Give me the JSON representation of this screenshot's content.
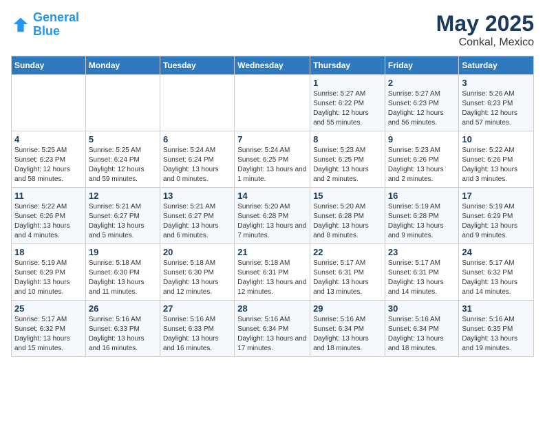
{
  "header": {
    "logo_general": "General",
    "logo_blue": "Blue",
    "month": "May 2025",
    "location": "Conkal, Mexico"
  },
  "weekdays": [
    "Sunday",
    "Monday",
    "Tuesday",
    "Wednesday",
    "Thursday",
    "Friday",
    "Saturday"
  ],
  "weeks": [
    [
      {
        "day": "",
        "sunrise": "",
        "sunset": "",
        "daylight": ""
      },
      {
        "day": "",
        "sunrise": "",
        "sunset": "",
        "daylight": ""
      },
      {
        "day": "",
        "sunrise": "",
        "sunset": "",
        "daylight": ""
      },
      {
        "day": "",
        "sunrise": "",
        "sunset": "",
        "daylight": ""
      },
      {
        "day": "1",
        "sunrise": "Sunrise: 5:27 AM",
        "sunset": "Sunset: 6:22 PM",
        "daylight": "Daylight: 12 hours and 55 minutes."
      },
      {
        "day": "2",
        "sunrise": "Sunrise: 5:27 AM",
        "sunset": "Sunset: 6:23 PM",
        "daylight": "Daylight: 12 hours and 56 minutes."
      },
      {
        "day": "3",
        "sunrise": "Sunrise: 5:26 AM",
        "sunset": "Sunset: 6:23 PM",
        "daylight": "Daylight: 12 hours and 57 minutes."
      }
    ],
    [
      {
        "day": "4",
        "sunrise": "Sunrise: 5:25 AM",
        "sunset": "Sunset: 6:23 PM",
        "daylight": "Daylight: 12 hours and 58 minutes."
      },
      {
        "day": "5",
        "sunrise": "Sunrise: 5:25 AM",
        "sunset": "Sunset: 6:24 PM",
        "daylight": "Daylight: 12 hours and 59 minutes."
      },
      {
        "day": "6",
        "sunrise": "Sunrise: 5:24 AM",
        "sunset": "Sunset: 6:24 PM",
        "daylight": "Daylight: 13 hours and 0 minutes."
      },
      {
        "day": "7",
        "sunrise": "Sunrise: 5:24 AM",
        "sunset": "Sunset: 6:25 PM",
        "daylight": "Daylight: 13 hours and 1 minute."
      },
      {
        "day": "8",
        "sunrise": "Sunrise: 5:23 AM",
        "sunset": "Sunset: 6:25 PM",
        "daylight": "Daylight: 13 hours and 2 minutes."
      },
      {
        "day": "9",
        "sunrise": "Sunrise: 5:23 AM",
        "sunset": "Sunset: 6:26 PM",
        "daylight": "Daylight: 13 hours and 2 minutes."
      },
      {
        "day": "10",
        "sunrise": "Sunrise: 5:22 AM",
        "sunset": "Sunset: 6:26 PM",
        "daylight": "Daylight: 13 hours and 3 minutes."
      }
    ],
    [
      {
        "day": "11",
        "sunrise": "Sunrise: 5:22 AM",
        "sunset": "Sunset: 6:26 PM",
        "daylight": "Daylight: 13 hours and 4 minutes."
      },
      {
        "day": "12",
        "sunrise": "Sunrise: 5:21 AM",
        "sunset": "Sunset: 6:27 PM",
        "daylight": "Daylight: 13 hours and 5 minutes."
      },
      {
        "day": "13",
        "sunrise": "Sunrise: 5:21 AM",
        "sunset": "Sunset: 6:27 PM",
        "daylight": "Daylight: 13 hours and 6 minutes."
      },
      {
        "day": "14",
        "sunrise": "Sunrise: 5:20 AM",
        "sunset": "Sunset: 6:28 PM",
        "daylight": "Daylight: 13 hours and 7 minutes."
      },
      {
        "day": "15",
        "sunrise": "Sunrise: 5:20 AM",
        "sunset": "Sunset: 6:28 PM",
        "daylight": "Daylight: 13 hours and 8 minutes."
      },
      {
        "day": "16",
        "sunrise": "Sunrise: 5:19 AM",
        "sunset": "Sunset: 6:28 PM",
        "daylight": "Daylight: 13 hours and 9 minutes."
      },
      {
        "day": "17",
        "sunrise": "Sunrise: 5:19 AM",
        "sunset": "Sunset: 6:29 PM",
        "daylight": "Daylight: 13 hours and 9 minutes."
      }
    ],
    [
      {
        "day": "18",
        "sunrise": "Sunrise: 5:19 AM",
        "sunset": "Sunset: 6:29 PM",
        "daylight": "Daylight: 13 hours and 10 minutes."
      },
      {
        "day": "19",
        "sunrise": "Sunrise: 5:18 AM",
        "sunset": "Sunset: 6:30 PM",
        "daylight": "Daylight: 13 hours and 11 minutes."
      },
      {
        "day": "20",
        "sunrise": "Sunrise: 5:18 AM",
        "sunset": "Sunset: 6:30 PM",
        "daylight": "Daylight: 13 hours and 12 minutes."
      },
      {
        "day": "21",
        "sunrise": "Sunrise: 5:18 AM",
        "sunset": "Sunset: 6:31 PM",
        "daylight": "Daylight: 13 hours and 12 minutes."
      },
      {
        "day": "22",
        "sunrise": "Sunrise: 5:17 AM",
        "sunset": "Sunset: 6:31 PM",
        "daylight": "Daylight: 13 hours and 13 minutes."
      },
      {
        "day": "23",
        "sunrise": "Sunrise: 5:17 AM",
        "sunset": "Sunset: 6:31 PM",
        "daylight": "Daylight: 13 hours and 14 minutes."
      },
      {
        "day": "24",
        "sunrise": "Sunrise: 5:17 AM",
        "sunset": "Sunset: 6:32 PM",
        "daylight": "Daylight: 13 hours and 14 minutes."
      }
    ],
    [
      {
        "day": "25",
        "sunrise": "Sunrise: 5:17 AM",
        "sunset": "Sunset: 6:32 PM",
        "daylight": "Daylight: 13 hours and 15 minutes."
      },
      {
        "day": "26",
        "sunrise": "Sunrise: 5:16 AM",
        "sunset": "Sunset: 6:33 PM",
        "daylight": "Daylight: 13 hours and 16 minutes."
      },
      {
        "day": "27",
        "sunrise": "Sunrise: 5:16 AM",
        "sunset": "Sunset: 6:33 PM",
        "daylight": "Daylight: 13 hours and 16 minutes."
      },
      {
        "day": "28",
        "sunrise": "Sunrise: 5:16 AM",
        "sunset": "Sunset: 6:34 PM",
        "daylight": "Daylight: 13 hours and 17 minutes."
      },
      {
        "day": "29",
        "sunrise": "Sunrise: 5:16 AM",
        "sunset": "Sunset: 6:34 PM",
        "daylight": "Daylight: 13 hours and 18 minutes."
      },
      {
        "day": "30",
        "sunrise": "Sunrise: 5:16 AM",
        "sunset": "Sunset: 6:34 PM",
        "daylight": "Daylight: 13 hours and 18 minutes."
      },
      {
        "day": "31",
        "sunrise": "Sunrise: 5:16 AM",
        "sunset": "Sunset: 6:35 PM",
        "daylight": "Daylight: 13 hours and 19 minutes."
      }
    ]
  ]
}
